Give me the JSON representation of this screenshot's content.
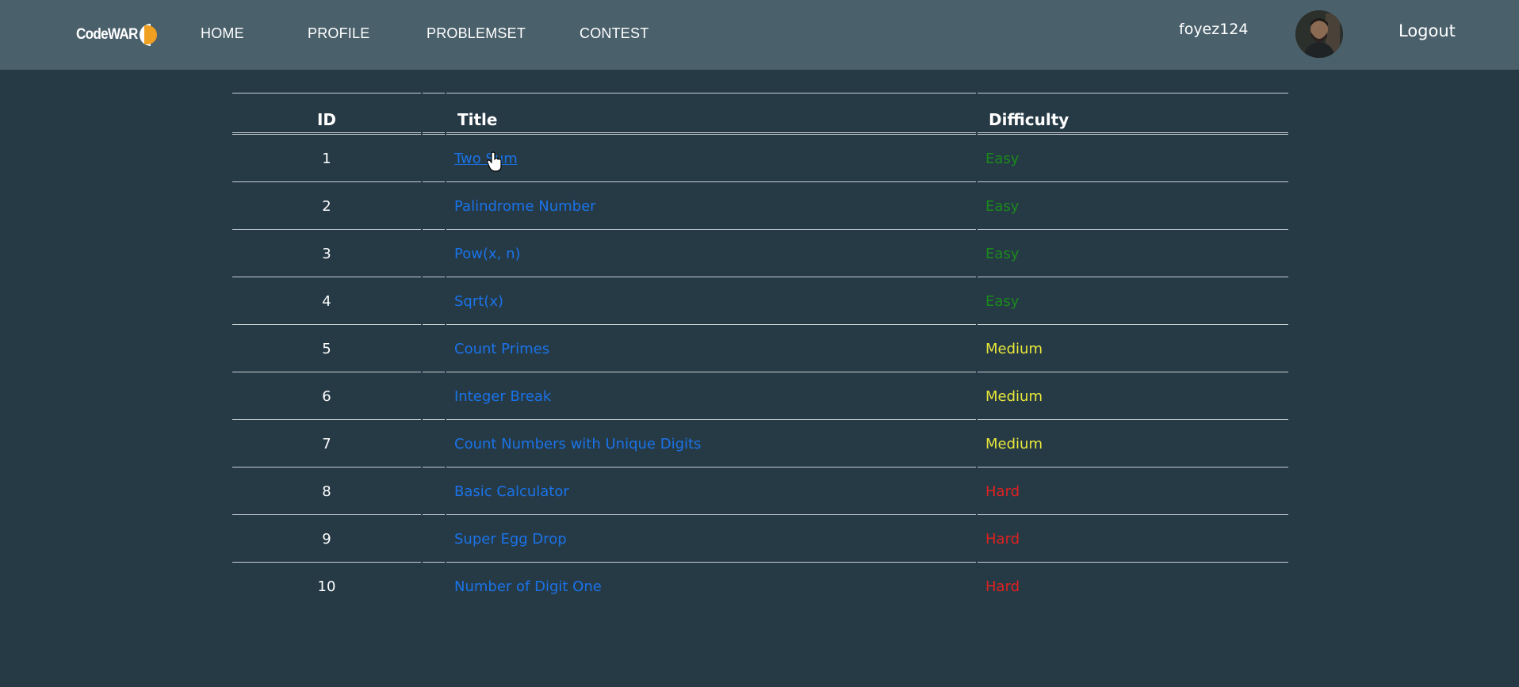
{
  "nav": {
    "logo_text": "CodeWAR",
    "links": [
      "HOME",
      "PROFILE",
      "PROBLEMSET",
      "CONTEST"
    ],
    "username": "foyez124",
    "logout": "Logout"
  },
  "table": {
    "headers": {
      "id": "ID",
      "title": "Title",
      "difficulty": "Difficulty"
    },
    "rows": [
      {
        "id": "1",
        "title": "Two Sum",
        "difficulty": "Easy"
      },
      {
        "id": "2",
        "title": "Palindrome Number",
        "difficulty": "Easy"
      },
      {
        "id": "3",
        "title": "Pow(x, n)",
        "difficulty": "Easy"
      },
      {
        "id": "4",
        "title": "Sqrt(x)",
        "difficulty": "Easy"
      },
      {
        "id": "5",
        "title": "Count Primes",
        "difficulty": "Medium"
      },
      {
        "id": "6",
        "title": "Integer Break",
        "difficulty": "Medium"
      },
      {
        "id": "7",
        "title": "Count Numbers with Unique Digits",
        "difficulty": "Medium"
      },
      {
        "id": "8",
        "title": "Basic Calculator",
        "difficulty": "Hard"
      },
      {
        "id": "9",
        "title": "Super Egg Drop",
        "difficulty": "Hard"
      },
      {
        "id": "10",
        "title": "Number of Digit One",
        "difficulty": "Hard"
      }
    ]
  },
  "colors": {
    "background": "#263a46",
    "navbar": "#4a606b",
    "link": "#1a73e8",
    "easy": "#1a8a1a",
    "medium": "#e8e83a",
    "hard": "#e02020",
    "logo_accent": "#f0a020"
  }
}
